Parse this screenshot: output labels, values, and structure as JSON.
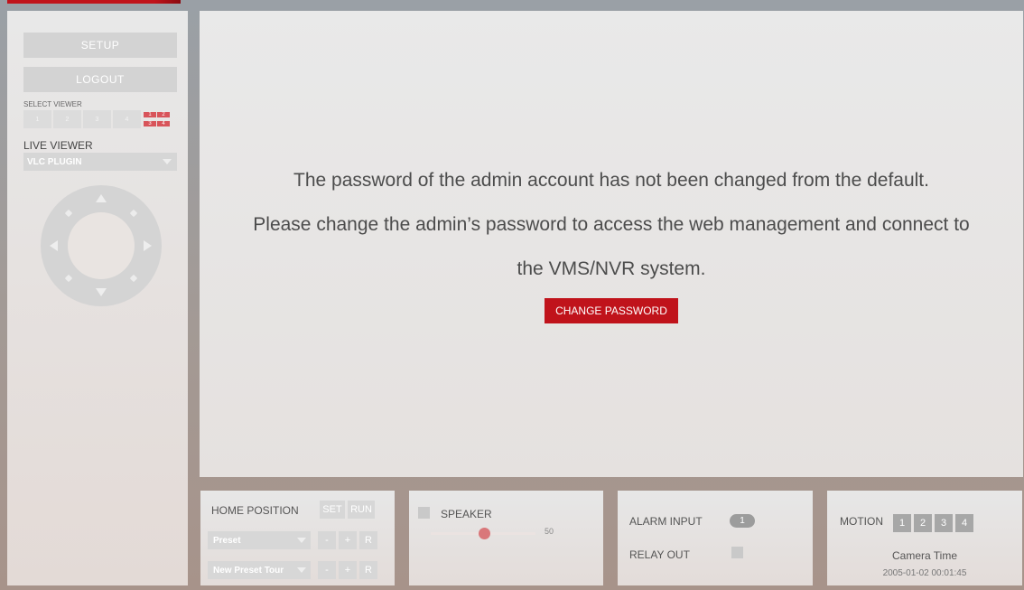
{
  "sidebar": {
    "setup_label": "SETUP",
    "logout_label": "LOGOUT",
    "select_viewer_label": "SELECT VIEWER",
    "viewer_buttons": [
      "1",
      "2",
      "3",
      "4"
    ],
    "viewer_quad": [
      "1",
      "2",
      "3",
      "4"
    ],
    "live_viewer_label": "LIVE VIEWER",
    "live_viewer_value": "VLC PLUGIN"
  },
  "main": {
    "message_line1": "The password of the admin account has not been changed from the default.",
    "message_line2": "Please change the admin’s password to access the web management and connect to",
    "message_line3": "the VMS/NVR system.",
    "change_password_label": "CHANGE PASSWORD"
  },
  "home_position": {
    "label": "HOME POSITION",
    "set_label": "SET",
    "run_label": "RUN",
    "preset_value": "Preset",
    "preset_tour_value": "New Preset Tour",
    "minus_label": "-",
    "plus_label": "+",
    "r_label": "R"
  },
  "speaker": {
    "label": "SPEAKER",
    "volume": "50",
    "volume_fraction": 0.5
  },
  "alarm": {
    "alarm_input_label": "ALARM INPUT",
    "alarm_input_value": "1",
    "relay_out_label": "RELAY OUT"
  },
  "motion": {
    "label": "MOTION",
    "zones": [
      "1",
      "2",
      "3",
      "4"
    ],
    "camera_time_label": "Camera Time",
    "camera_time_value": "2005-01-02 00:01:45"
  },
  "colors": {
    "accent": "#c0131b",
    "quad_active": "#d8545a"
  }
}
